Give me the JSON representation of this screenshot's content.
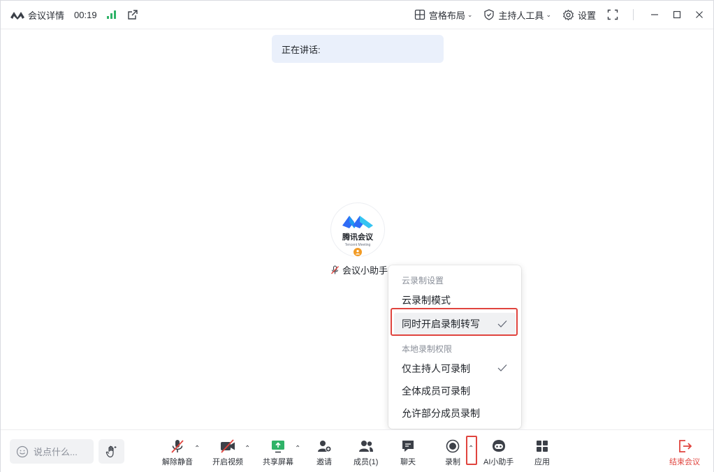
{
  "titlebar": {
    "title": "会议详情",
    "duration": "00:19",
    "layout_label": "宫格布局",
    "host_tools_label": "主持人工具",
    "settings_label": "设置"
  },
  "speaking": {
    "label": "正在讲话:"
  },
  "participant": {
    "avatar_brand": "腾讯会议",
    "avatar_sub": "Tencent Meeting",
    "name": "会议小助手"
  },
  "menu": {
    "cloud_section": "云录制设置",
    "cloud_items": [
      {
        "label": "云录制模式",
        "checked": false
      },
      {
        "label": "同时开启录制转写",
        "checked": true
      }
    ],
    "local_section": "本地录制权限",
    "local_items": [
      {
        "label": "仅主持人可录制",
        "checked": true
      },
      {
        "label": "全体成员可录制",
        "checked": false
      },
      {
        "label": "允许部分成员录制",
        "checked": false
      }
    ]
  },
  "toolbar": {
    "chat_placeholder": "说点什么...",
    "unmute": "解除静音",
    "start_video": "开启视频",
    "share_screen": "共享屏幕",
    "invite": "邀请",
    "members": "成员(1)",
    "chat": "聊天",
    "record": "录制",
    "ai_assistant": "AI小助手",
    "apps": "应用",
    "end_meeting": "结束会议"
  },
  "colors": {
    "accent_red": "#e0443e",
    "signal_green": "#2fb368",
    "brand_blue": "#2f6cf6",
    "host_badge": "#f29b25"
  }
}
